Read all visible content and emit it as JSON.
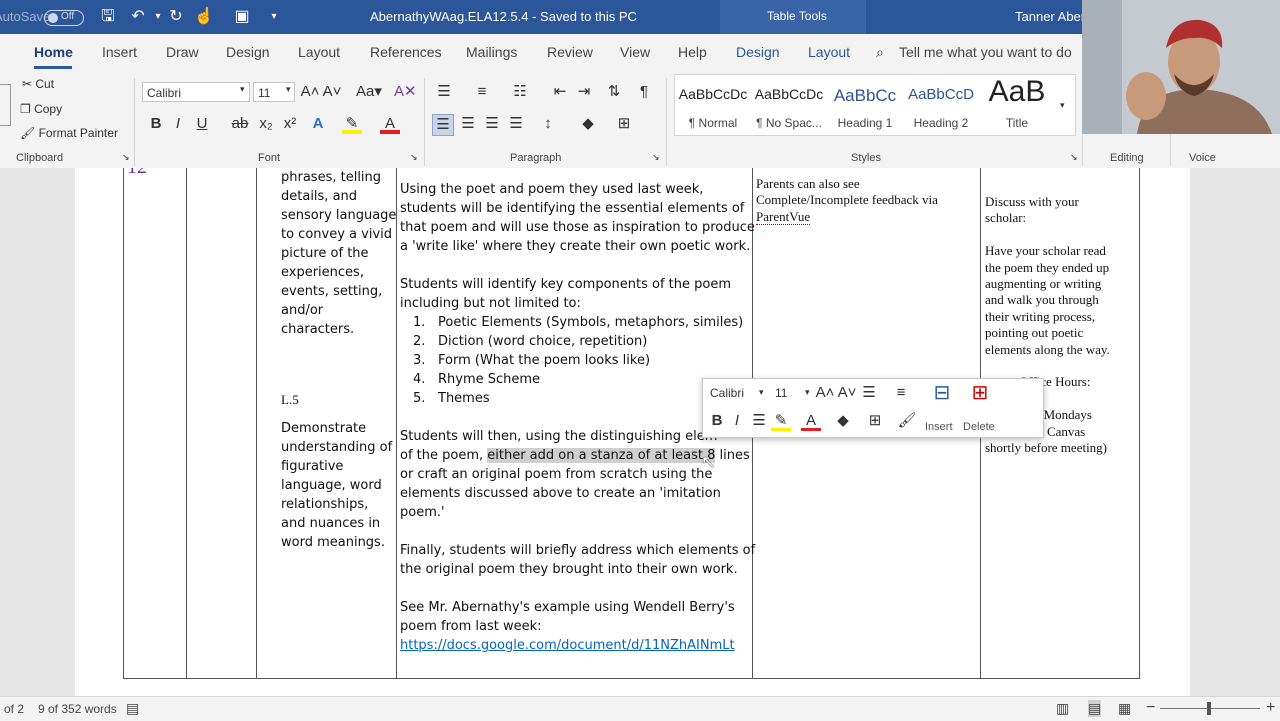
{
  "titlebar": {
    "autosave_label": "AutoSave",
    "autosave_state": "Off",
    "doc_title": "AbernathyWAag.ELA12.5.4  -  Saved to this PC",
    "context_tab": "Table Tools",
    "user_name": "Tanner Aber"
  },
  "tabs": [
    "Home",
    "Insert",
    "Draw",
    "Design",
    "Layout",
    "References",
    "Mailings",
    "Review",
    "View",
    "Help",
    "Design",
    "Layout"
  ],
  "tell_me": "Tell me what you want to do",
  "ribbon": {
    "clipboard": {
      "cut": "Cut",
      "copy": "Copy",
      "format_painter": "Format Painter",
      "label": "Clipboard"
    },
    "font": {
      "name": "Calibri",
      "size": "11",
      "label": "Font"
    },
    "paragraph": {
      "label": "Paragraph"
    },
    "styles": {
      "label": "Styles",
      "items": [
        {
          "preview": "AaBbCcDc",
          "name": "¶ Normal"
        },
        {
          "preview": "AaBbCcDc",
          "name": "¶ No Spac..."
        },
        {
          "preview": "AaBbCc",
          "name": "Heading 1"
        },
        {
          "preview": "AaBbCcD",
          "name": "Heading 2"
        },
        {
          "preview": "AaB",
          "name": "Title"
        }
      ]
    },
    "editing": {
      "label": "Editing"
    },
    "voice": {
      "label": "Voice"
    }
  },
  "document": {
    "row_number": "12",
    "standards_top": [
      "phrases, telling",
      "details, and",
      "sensory language",
      "to convey a vivid",
      "picture of the",
      "experiences,",
      "events, setting,",
      "and/or",
      "characters."
    ],
    "standard_code": "L.5",
    "standards_bottom": [
      "Demonstrate",
      "understanding of",
      "figurative",
      "language, word",
      "relationships,",
      "and nuances in",
      "word meanings."
    ],
    "activity_intro": [
      "Using the poet and poem they used last week,",
      "students will be identifying the essential elements of",
      "that poem and will use those as inspiration to produce",
      "a 'write like' where they create their own poetic work."
    ],
    "activity_identify": [
      "Students will identify key components of the poem",
      "including but not limited to:"
    ],
    "components": [
      "Poetic Elements (Symbols, metaphors, similes)",
      "Diction (word choice, repetition)",
      "Form (What the poem looks like)",
      "Rhyme Scheme",
      "Themes"
    ],
    "then_line1": "Students will then, using the distinguishing elem",
    "then_line2_pre": "of the poem, ",
    "then_line2_hl": "either add on a stanza of at least 8",
    "then_line2_post": " lines",
    "then_rest": [
      "or craft an original poem from scratch using the",
      "elements discussed above to create an 'imitation",
      "poem.'"
    ],
    "finally": [
      "Finally, students will briefly address which elements of",
      "the original poem they brought into their own work."
    ],
    "example": [
      "See Mr. Abernathy's example using Wendell Berry's",
      "poem from last week:"
    ],
    "link": "https://docs.google.com/document/d/11NZhAINmLt",
    "feedback": [
      "Parents can also see",
      "Complete/Incomplete feedback via"
    ],
    "feedback_parentvue": "ParentVue",
    "discuss": [
      "Discuss with your",
      "scholar:"
    ],
    "discuss_body": [
      "Have your scholar read",
      "the poem they ended up",
      "augmenting or writing",
      "and walk you through",
      "their writing process,",
      "pointing out poetic",
      "elements along the way."
    ],
    "office_hours": [
      "om Office Hours:",
      ":30-11am Mondays",
      "nd link on Canvas",
      "shortly before meeting)"
    ]
  },
  "mini_toolbar": {
    "font": "Calibri",
    "size": "11",
    "insert": "Insert",
    "delete": "Delete"
  },
  "statusbar": {
    "page": "of 2",
    "words": "9 of 352 words"
  }
}
